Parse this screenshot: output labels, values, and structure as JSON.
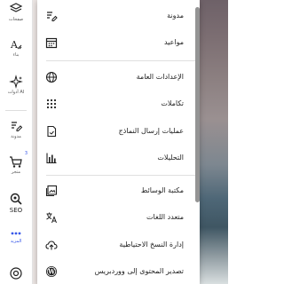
{
  "sidebar": {
    "pages_label": "صفحات",
    "design_label": "بناء",
    "ai_label": "أدوات AI",
    "blog_label": "مدونة",
    "store_label": "متجر",
    "store_badge": "3",
    "seo_label": "SEO",
    "more_label": "المزيد",
    "bottom_icon": "help-icon"
  },
  "menu": {
    "items": [
      {
        "label": "مدونة",
        "icon": "blog-icon"
      },
      {
        "label": "مواعيد",
        "icon": "calendar-icon"
      },
      {
        "label": "الإعدادات العامة",
        "icon": "globe-icon"
      },
      {
        "label": "تكاملات",
        "icon": "grid-icon"
      },
      {
        "label": "عمليات إرسال النماذج",
        "icon": "form-icon"
      },
      {
        "label": "التحليلات",
        "icon": "chart-icon"
      },
      {
        "label": "مكتبة الوسائط",
        "icon": "media-icon"
      },
      {
        "label": "متعدد اللغات",
        "icon": "translate-icon"
      },
      {
        "label": "إدارة النسخ الاحتياطية",
        "icon": "cloud-upload-icon"
      },
      {
        "label": "تصدير المحتوى إلى ووردبريس",
        "icon": "wordpress-icon"
      }
    ]
  },
  "colors": {
    "accent": "#3858e9",
    "text": "#1e1e1e"
  }
}
